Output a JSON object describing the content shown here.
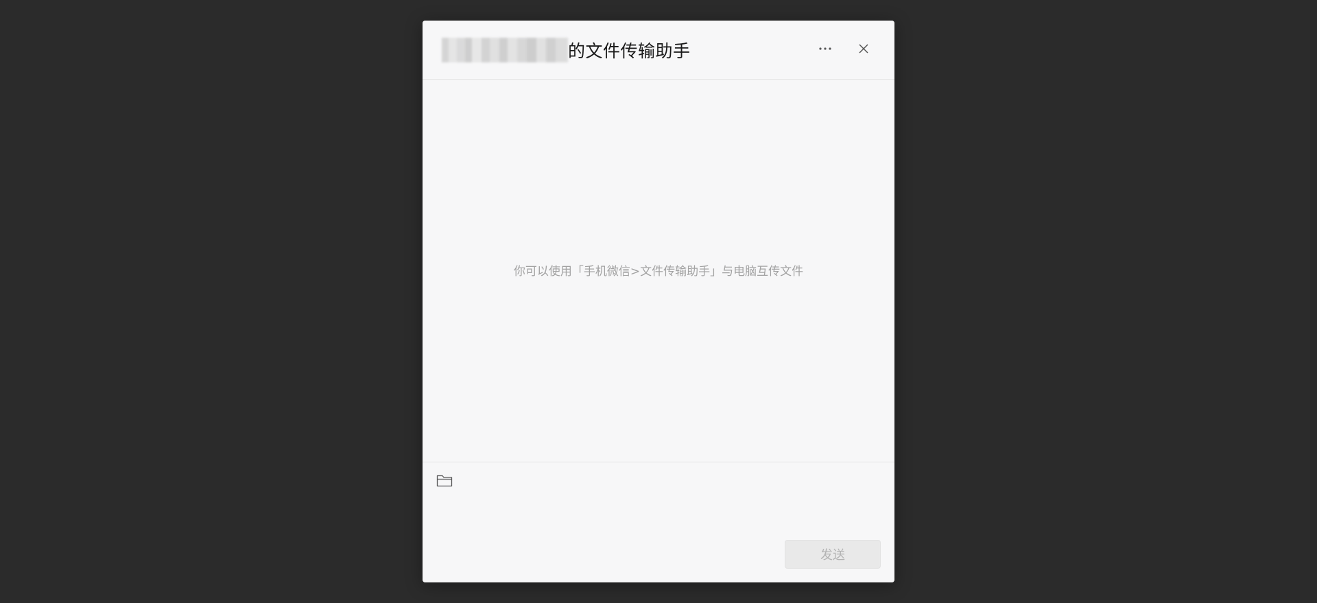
{
  "dialog": {
    "title_suffix": "的文件传输助手",
    "title_redacted_name": "",
    "more_icon": "more-horizontal-icon",
    "close_icon": "close-icon"
  },
  "messages": {
    "empty_hint": "你可以使用「手机微信>文件传输助手」与电脑互传文件"
  },
  "composer": {
    "file_icon": "folder-icon",
    "input_value": "",
    "send_label": "发送"
  },
  "colors": {
    "background": "#2b2b2b",
    "dialog_bg": "#f7f7f8",
    "hint_text": "#a2a2a2",
    "send_disabled_bg": "#e9e9e9",
    "send_disabled_text": "#b3b3b3"
  }
}
